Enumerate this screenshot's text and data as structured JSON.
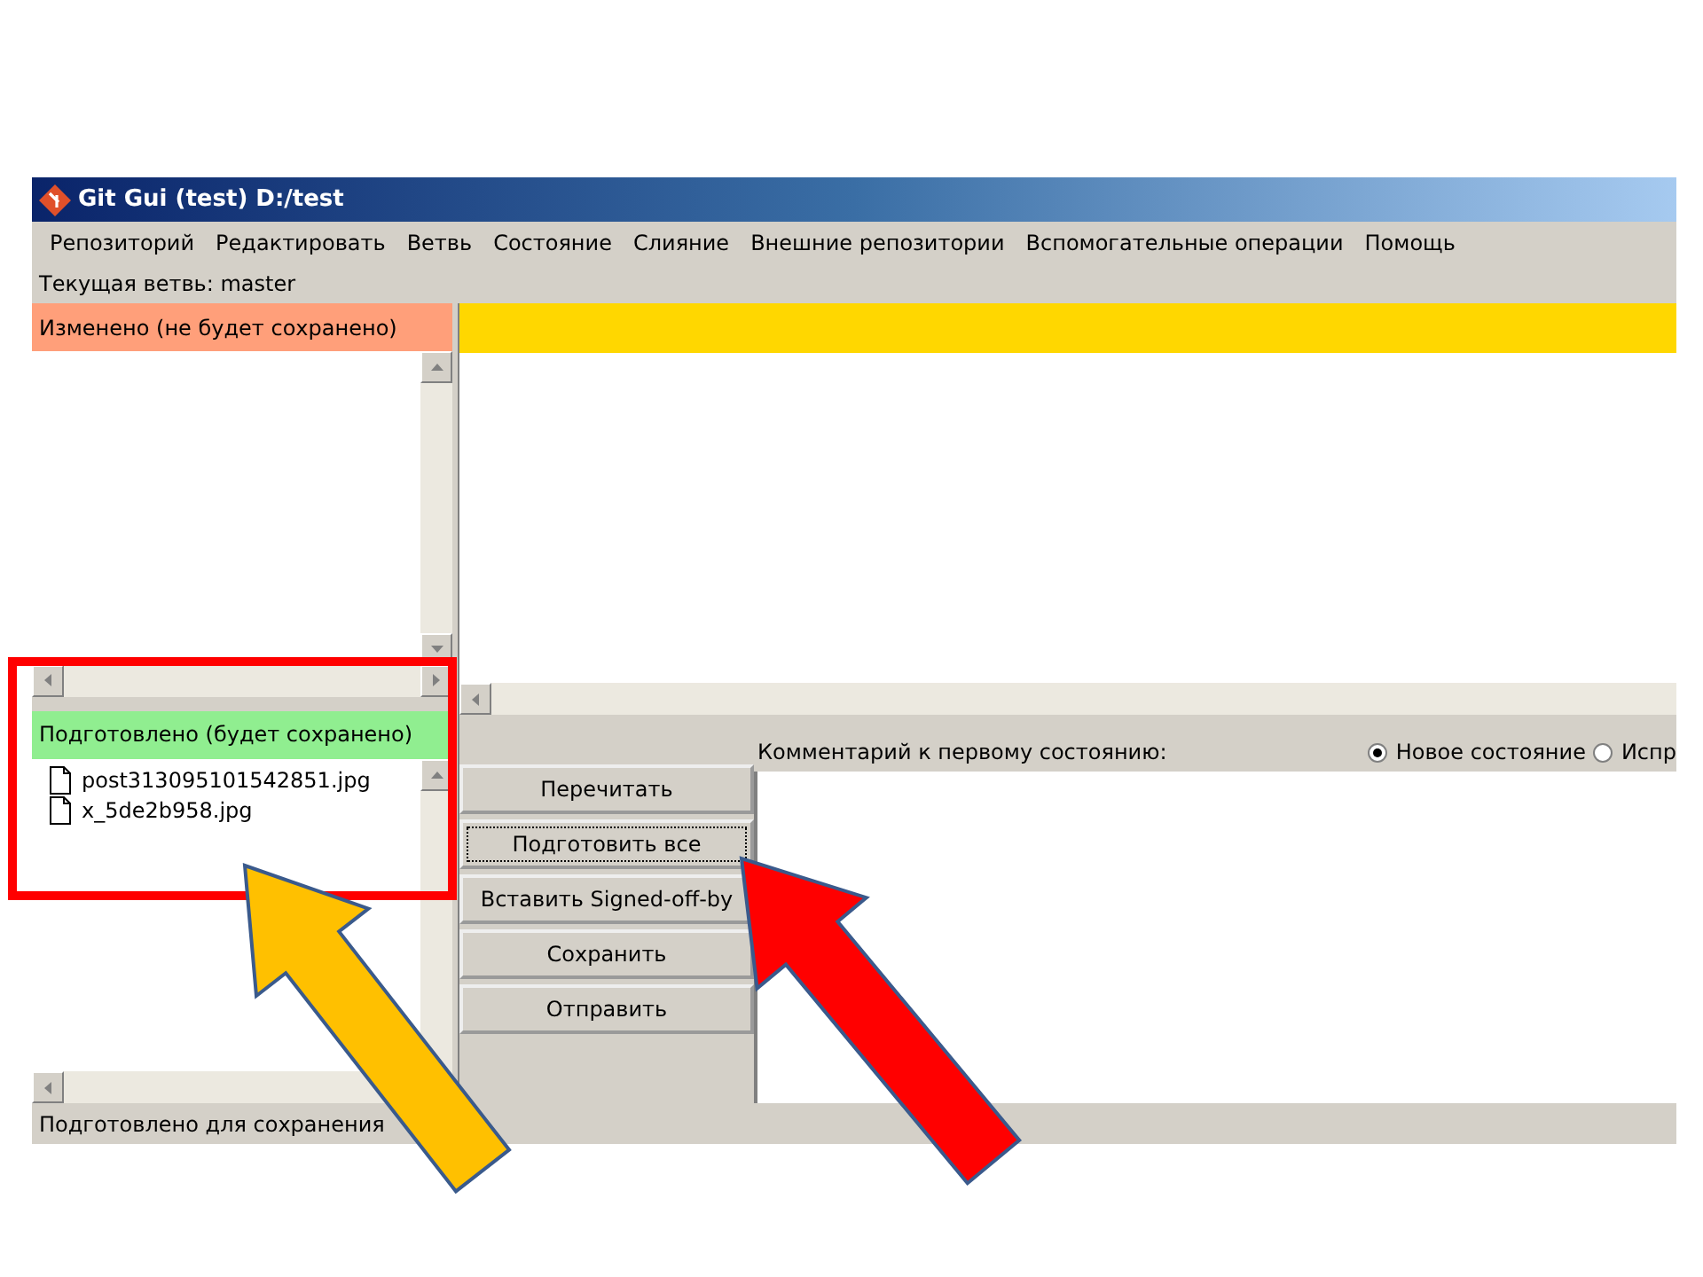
{
  "window": {
    "title": "Git Gui (test) D:/test"
  },
  "menu": [
    "Репозиторий",
    "Редактировать",
    "Ветвь",
    "Состояние",
    "Слияние",
    "Внешние репозитории",
    "Вспомогательные операции",
    "Помощь"
  ],
  "current_branch": "Текущая ветвь: master",
  "unstaged": {
    "header": "Изменено (не будет сохранено)"
  },
  "staged": {
    "header": "Подготовлено (будет сохранено)",
    "files": [
      "post313095101542851.jpg",
      "x_5de2b958.jpg"
    ]
  },
  "buttons": [
    {
      "label": "Перечитать",
      "focused": false
    },
    {
      "label": "Подготовить все",
      "focused": true
    },
    {
      "label": "Вставить Signed-off-by",
      "focused": false
    },
    {
      "label": "Сохранить",
      "focused": false
    },
    {
      "label": "Отправить",
      "focused": false
    }
  ],
  "comment": {
    "label": "Комментарий к первому состоянию:",
    "options": [
      {
        "label": "Новое состояние",
        "selected": true
      },
      {
        "label": "Испр",
        "selected": false
      }
    ]
  },
  "status_bar": "Подготовлено для сохранения",
  "annotations": [
    {
      "kind": "frame",
      "color": "#ff0000"
    },
    {
      "kind": "arrow",
      "color": "#ffc000"
    },
    {
      "kind": "arrow",
      "color": "#ff0000"
    }
  ]
}
